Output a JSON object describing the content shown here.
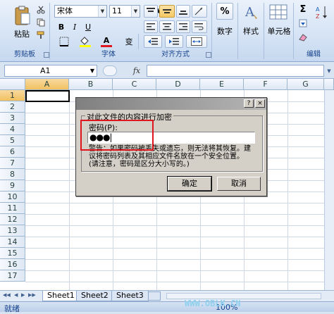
{
  "ribbon": {
    "clipboard": {
      "paste_label": "粘贴",
      "group_label": "剪贴板"
    },
    "font": {
      "name": "宋体",
      "size": "11",
      "grow": "A",
      "shrink": "A",
      "bold": "B",
      "italic": "I",
      "underline": "U",
      "font_color": "A",
      "phonetic": "变",
      "group_label": "字体"
    },
    "alignment": {
      "group_label": "对齐方式"
    },
    "number": {
      "label": "数字",
      "symbol": "%"
    },
    "styles": {
      "label": "样式"
    },
    "cells": {
      "label": "单元格"
    },
    "editing": {
      "group_label": "编辑",
      "sum": "Σ"
    }
  },
  "formula_bar": {
    "name_box": "A1",
    "fx": "fx",
    "value": ""
  },
  "grid": {
    "columns": [
      "A",
      "B",
      "C",
      "D",
      "E",
      "F",
      "G"
    ],
    "rows": [
      "1",
      "2",
      "3",
      "4",
      "5",
      "6",
      "7",
      "8",
      "9",
      "10",
      "11",
      "12",
      "13",
      "14",
      "15",
      "16",
      "17"
    ],
    "active_cell": "A1"
  },
  "sheets": [
    "Sheet1",
    "Sheet2",
    "Sheet3"
  ],
  "status": {
    "ready": "就绪",
    "zoom": "100%"
  },
  "dialog": {
    "group_label": "对此文件的内容进行加密",
    "password_label": "密码(P):",
    "password_value": "●●●|",
    "warning_line1": "警告：如果密码被丢失或遗忘，则无法将其恢复。建",
    "warning_line2": "议将密码列表及其相应文件名放在一个安全位置。",
    "warning_line3": "(请注意，密码是区分大小写的。)",
    "ok": "确定",
    "cancel": "取消",
    "help": "?",
    "close": "×"
  },
  "watermark": "WWW.OBLK.CN"
}
